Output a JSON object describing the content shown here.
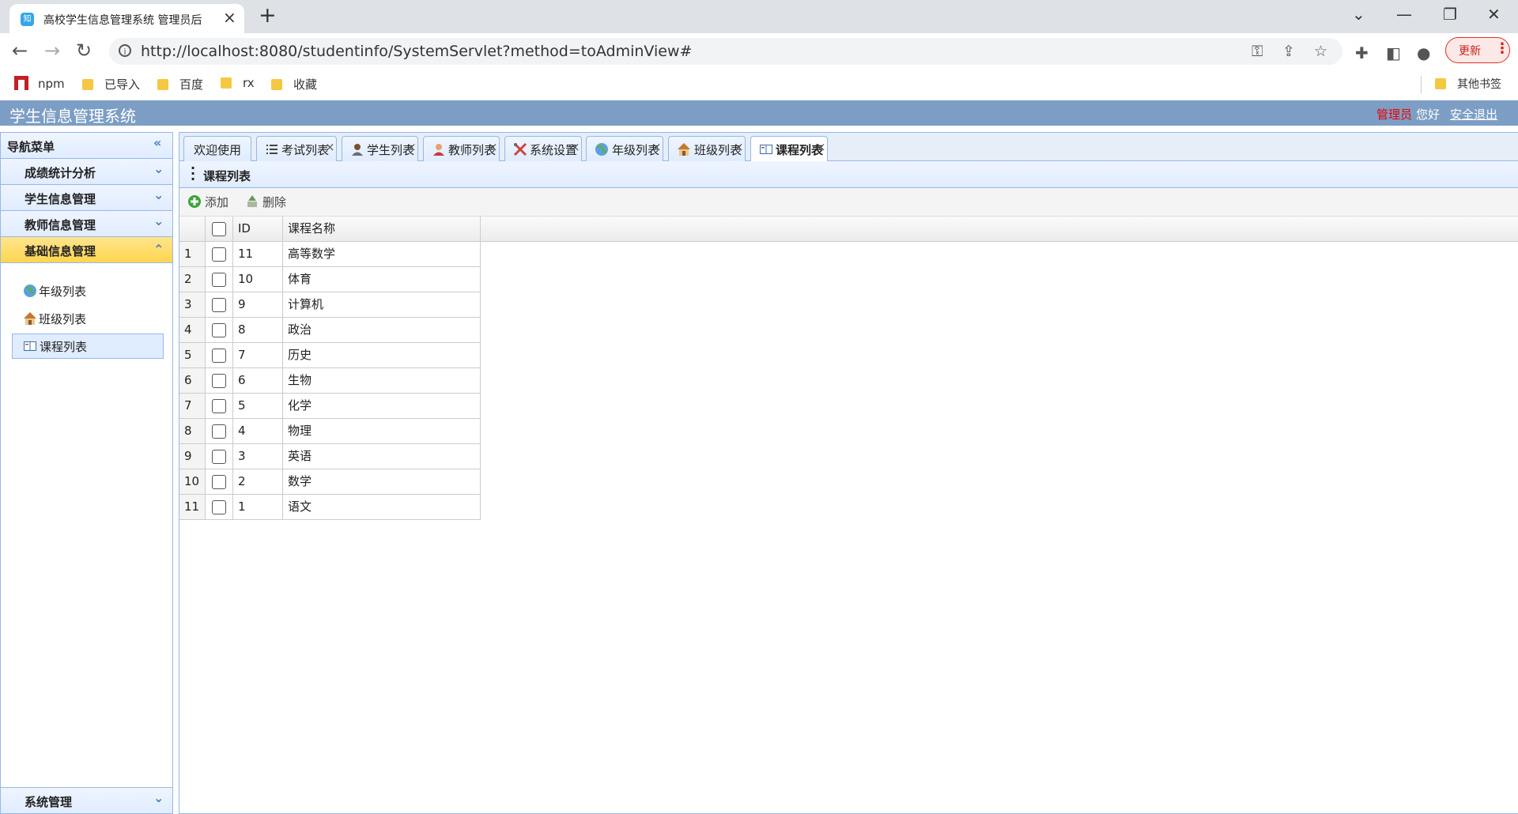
{
  "browser": {
    "tab_title": "高校学生信息管理系统 管理员后",
    "tab_favicon": "知",
    "url": "http://localhost:8080/studentinfo/SystemServlet?method=toAdminView#",
    "update_label": "更新",
    "bookmarks": [
      {
        "label": "npm",
        "icon": "npm-logo"
      },
      {
        "label": "已导入",
        "icon": "folder-icon"
      },
      {
        "label": "百度",
        "icon": "folder-icon"
      },
      {
        "label": "rx",
        "icon": "folder-icon"
      },
      {
        "label": "收藏",
        "icon": "folder-icon"
      }
    ],
    "other_bookmarks": "其他书签"
  },
  "app": {
    "title": "学生信息管理系统",
    "admin_label": "管理员",
    "hello_label": "您好",
    "logout_label": "安全退出"
  },
  "sidebar": {
    "nav_title": "导航菜单",
    "sections": [
      {
        "label": "成绩统计分析"
      },
      {
        "label": "学生信息管理"
      },
      {
        "label": "教师信息管理"
      },
      {
        "label": "基础信息管理"
      }
    ],
    "items": [
      {
        "label": "年级列表",
        "icon": "globe-icon"
      },
      {
        "label": "班级列表",
        "icon": "house-icon"
      },
      {
        "label": "课程列表",
        "icon": "book-icon"
      }
    ],
    "bottom_section": "系统管理"
  },
  "tabs": [
    {
      "label": "欢迎使用",
      "icon": ""
    },
    {
      "label": "考试列表",
      "icon": "list-icon"
    },
    {
      "label": "学生列表",
      "icon": "student-icon"
    },
    {
      "label": "教师列表",
      "icon": "teacher-icon"
    },
    {
      "label": "系统设置",
      "icon": "tools-icon"
    },
    {
      "label": "年级列表",
      "icon": "globe-icon"
    },
    {
      "label": "班级列表",
      "icon": "house-icon"
    },
    {
      "label": "课程列表",
      "icon": "book-icon"
    }
  ],
  "panel": {
    "title": "课程列表",
    "add_label": "添加",
    "delete_label": "删除",
    "columns": [
      "ID",
      "课程名称"
    ],
    "rows": [
      {
        "n": "1",
        "id": "11",
        "name": "高等数学"
      },
      {
        "n": "2",
        "id": "10",
        "name": "体育"
      },
      {
        "n": "3",
        "id": "9",
        "name": "计算机"
      },
      {
        "n": "4",
        "id": "8",
        "name": "政治"
      },
      {
        "n": "5",
        "id": "7",
        "name": "历史"
      },
      {
        "n": "6",
        "id": "6",
        "name": "生物"
      },
      {
        "n": "7",
        "id": "5",
        "name": "化学"
      },
      {
        "n": "8",
        "id": "4",
        "name": "物理"
      },
      {
        "n": "9",
        "id": "3",
        "name": "英语"
      },
      {
        "n": "10",
        "id": "2",
        "name": "数学"
      },
      {
        "n": "11",
        "id": "1",
        "name": "语文"
      }
    ]
  }
}
